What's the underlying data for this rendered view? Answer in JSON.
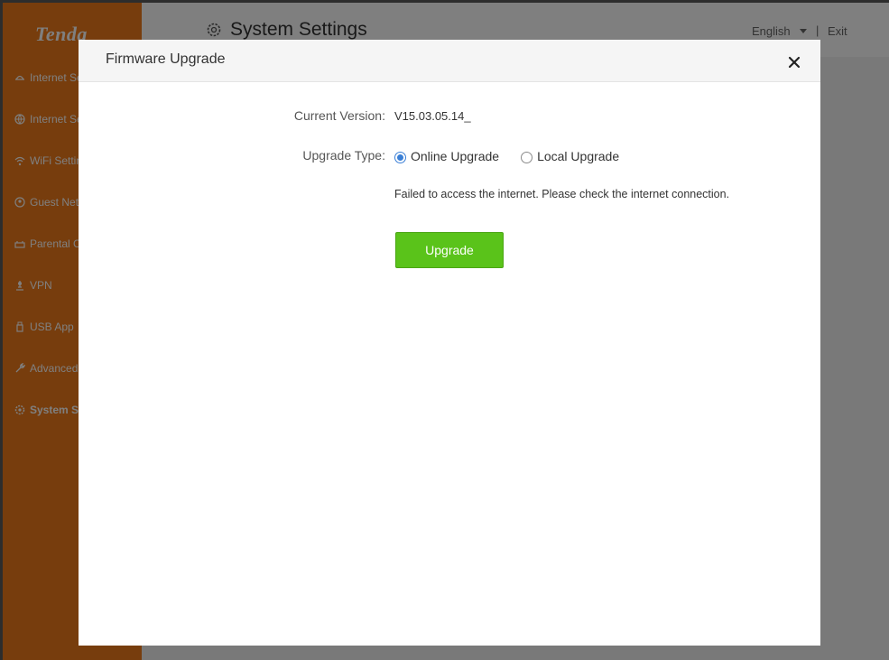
{
  "sidebar": {
    "logo": "Tenda",
    "items": [
      {
        "label": "Internet Settings",
        "icon": "globe-arrow-icon"
      },
      {
        "label": "Internet Settings",
        "icon": "globe-icon"
      },
      {
        "label": "WiFi Settings",
        "icon": "wifi-icon"
      },
      {
        "label": "Guest Network",
        "icon": "guest-icon"
      },
      {
        "label": "Parental Control",
        "icon": "parental-icon"
      },
      {
        "label": "VPN",
        "icon": "vpn-icon"
      },
      {
        "label": "USB App",
        "icon": "usb-icon"
      },
      {
        "label": "Advanced",
        "icon": "wrench-icon"
      },
      {
        "label": "System Settings",
        "icon": "gear-icon",
        "active": true
      }
    ],
    "color": "#ef7b1a"
  },
  "header": {
    "title": "System Settings",
    "language": "English",
    "separator": "|",
    "exit": "Exit"
  },
  "modal": {
    "title": "Firmware Upgrade",
    "current_version_label": "Current Version:",
    "current_version_value": "V15.03.05.14_",
    "upgrade_type_label": "Upgrade Type:",
    "options": [
      {
        "label": "Online Upgrade",
        "checked": true
      },
      {
        "label": "Local Upgrade",
        "checked": false
      }
    ],
    "message": "Failed to access the internet. Please check the internet connection.",
    "upgrade_button": "Upgrade",
    "button_color": "#5ac31a",
    "radio_color": "#3a7fd6"
  }
}
